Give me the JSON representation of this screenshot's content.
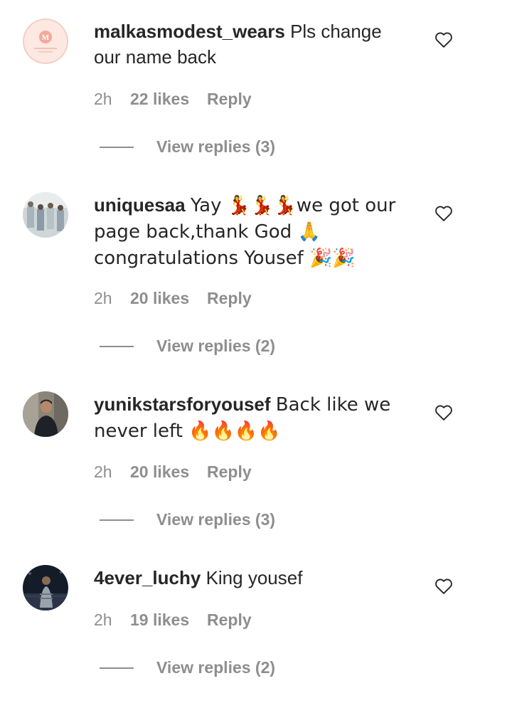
{
  "comments": [
    {
      "username": "malkasmodest_wears",
      "text": "Pls change our name back",
      "time": "2h",
      "likes": "22 likes",
      "reply_label": "Reply",
      "view_replies": "View replies (3)",
      "avatar_icon": "brand-logo-avatar"
    },
    {
      "username": "uniquesaa",
      "text": "Yay 💃💃💃we got our page back,thank God 🙏 congratulations Yousef 🎉🎉",
      "time": "2h",
      "likes": "20 likes",
      "reply_label": "Reply",
      "view_replies": "View replies (2)",
      "avatar_icon": "group-photo-avatar"
    },
    {
      "username": "yunikstarsforyousef",
      "text": "Back like we never left 🔥🔥🔥🔥",
      "time": "2h",
      "likes": "20 likes",
      "reply_label": "Reply",
      "view_replies": "View replies (3)",
      "avatar_icon": "person-photo-avatar"
    },
    {
      "username": "4ever_luchy",
      "text": "King yousef",
      "time": "2h",
      "likes": "19 likes",
      "reply_label": "Reply",
      "view_replies": "View replies (2)",
      "avatar_icon": "stage-photo-avatar"
    }
  ],
  "colors": {
    "text": "#262626",
    "secondary": "#8e8e8e",
    "background": "#ffffff"
  },
  "icons": {
    "like": "heart-outline-icon"
  }
}
